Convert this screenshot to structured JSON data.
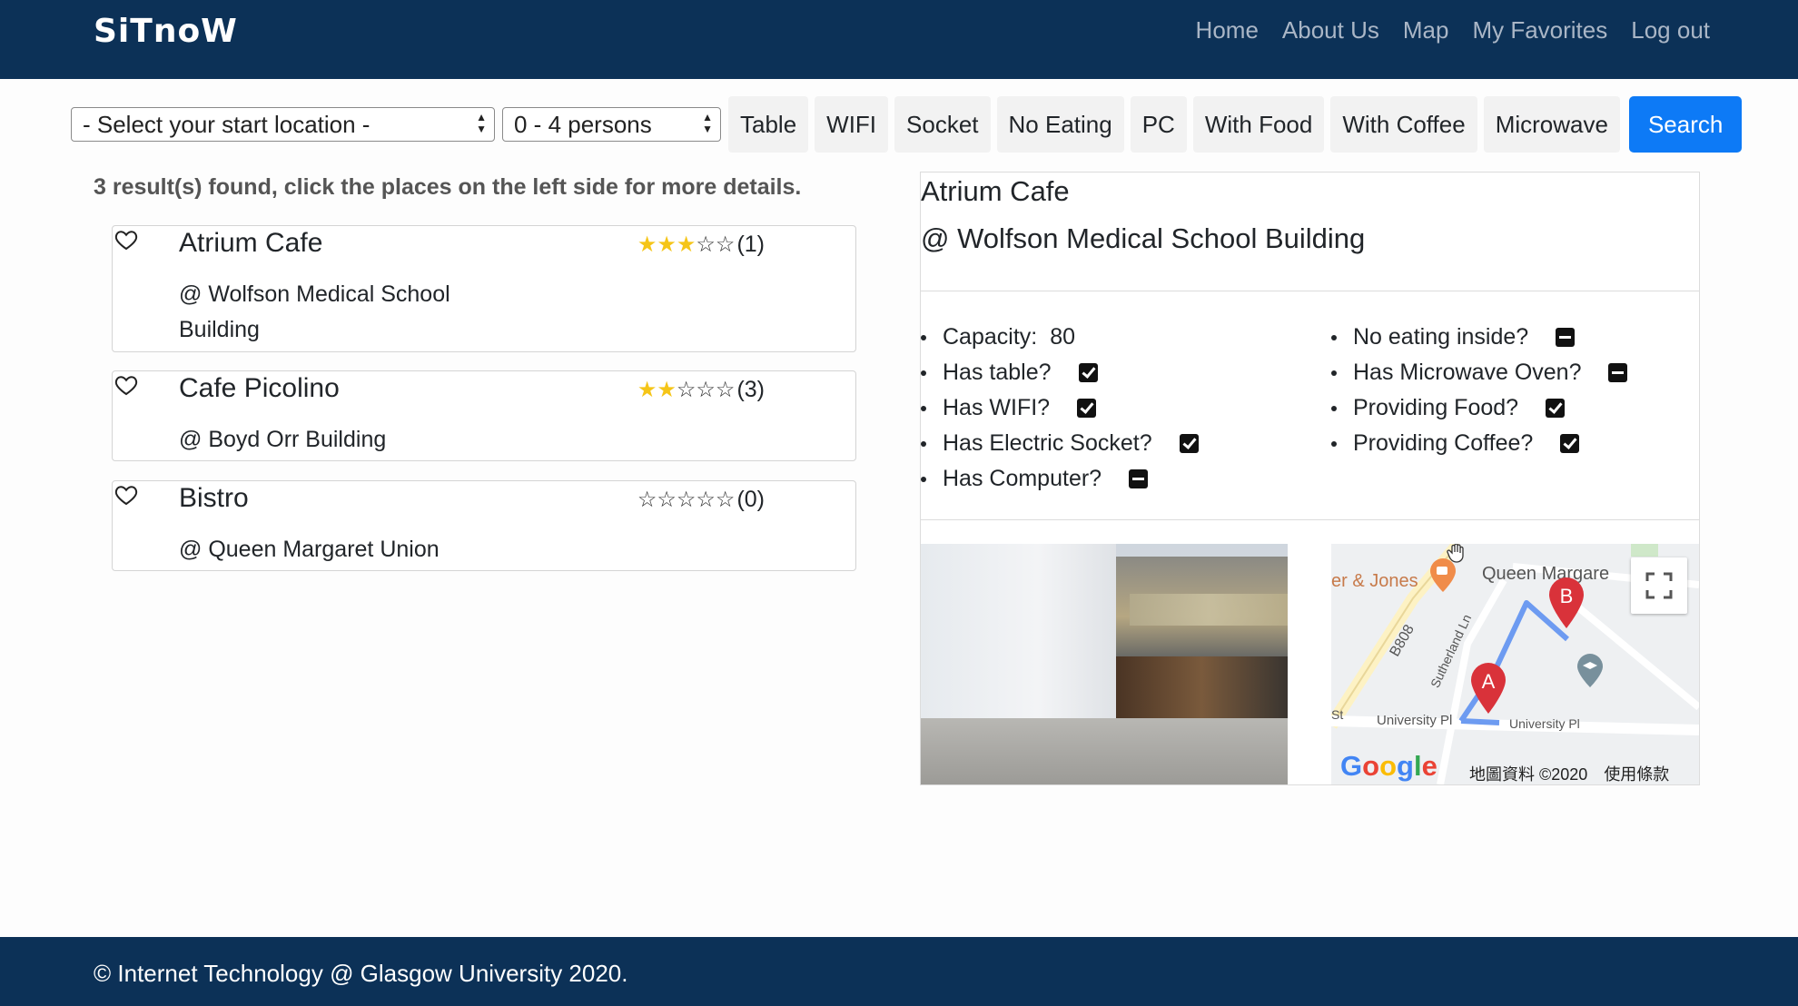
{
  "navbar": {
    "brand": "SiTnoW",
    "links": [
      "Home",
      "About Us",
      "Map",
      "My Favorites",
      "Log out"
    ]
  },
  "filters": {
    "location_select": "- Select your start location -",
    "size_select": "0 - 4 persons",
    "toggles": [
      "Table",
      "WIFI",
      "Socket",
      "No Eating",
      "PC",
      "With Food",
      "With Coffee",
      "Microwave"
    ],
    "search_label": "Search"
  },
  "results": {
    "message": "3 result(s) found, click the places on the left side for more details.",
    "items": [
      {
        "name": "Atrium Cafe",
        "building": "@ Wolfson Medical School Building",
        "stars": 3,
        "max_stars": 5,
        "count": "(1)"
      },
      {
        "name": "Cafe Picolino",
        "building": "@ Boyd Orr Building",
        "stars": 2,
        "max_stars": 5,
        "count": "(3)"
      },
      {
        "name": "Bistro",
        "building": "@ Queen Margaret Union",
        "stars": 0,
        "max_stars": 5,
        "count": "(0)"
      }
    ]
  },
  "detail": {
    "title": "Atrium Cafe",
    "subtitle": "@ Wolfson Medical School Building",
    "left_features": [
      {
        "label": "Capacity:",
        "value": "80"
      },
      {
        "label": "Has table?",
        "state": "checked"
      },
      {
        "label": "Has WIFI?",
        "state": "checked"
      },
      {
        "label": "Has Electric Socket?",
        "state": "checked"
      },
      {
        "label": "Has Computer?",
        "state": "indeterminate"
      }
    ],
    "right_features": [
      {
        "label": "No eating inside?",
        "state": "indeterminate"
      },
      {
        "label": "Has Microwave Oven?",
        "state": "indeterminate"
      },
      {
        "label": "Providing Food?",
        "state": "checked"
      },
      {
        "label": "Providing Coffee?",
        "state": "checked"
      }
    ],
    "map": {
      "labels": [
        "er & Jones",
        "Queen Margare",
        "B808",
        "Sutherland Ln",
        "University Pl",
        "University Pl",
        "St"
      ],
      "markers": [
        "A",
        "B"
      ],
      "google_logo": "Google",
      "attribution": "地圖資料 ©2020",
      "terms": "使用條款"
    }
  },
  "footer": {
    "text": "© Internet Technology @ Glasgow University 2020."
  },
  "colors": {
    "navbar": "#0c3157",
    "primary": "#0d7af6",
    "star": "#f5c518",
    "marker": "#d9323a"
  }
}
